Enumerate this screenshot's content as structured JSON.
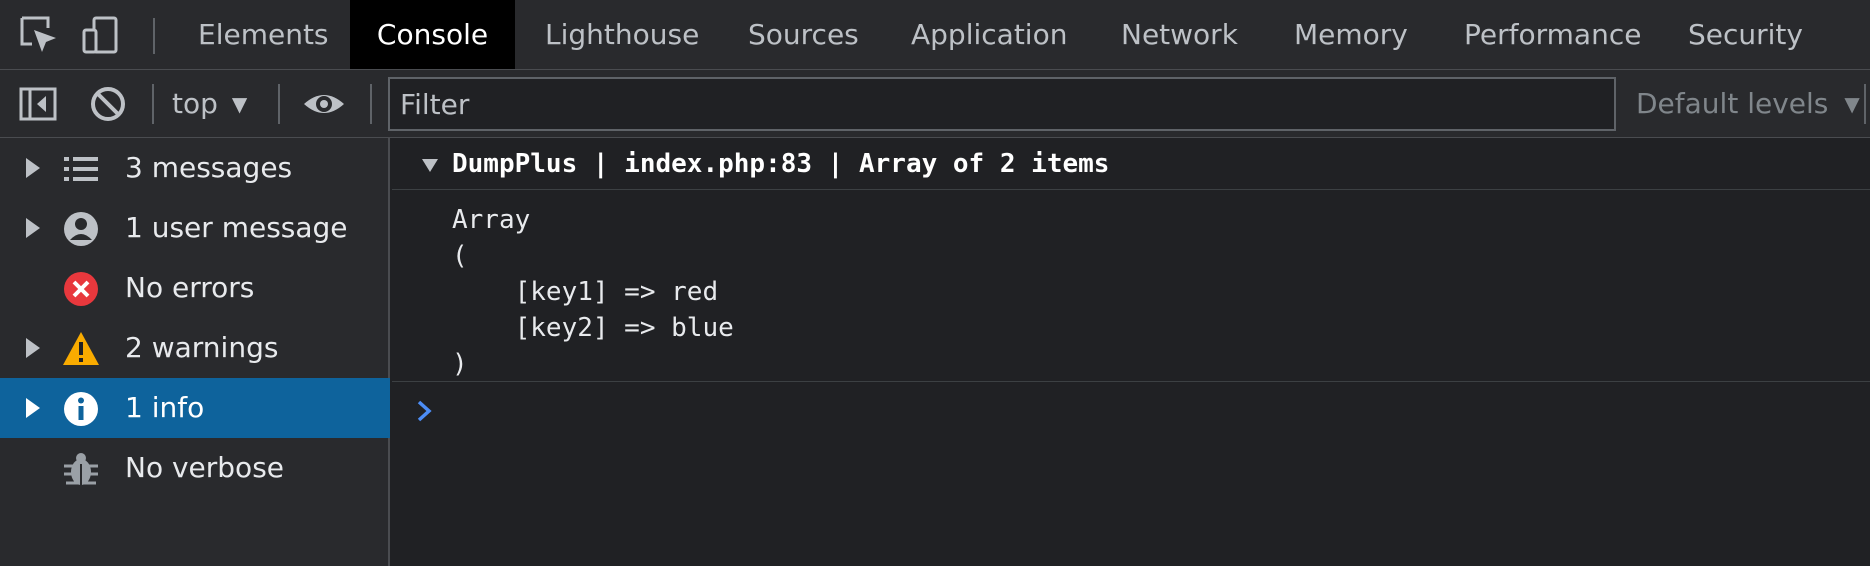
{
  "tabs": [
    {
      "label": "Elements",
      "active": false
    },
    {
      "label": "Console",
      "active": true
    },
    {
      "label": "Lighthouse",
      "active": false
    },
    {
      "label": "Sources",
      "active": false
    },
    {
      "label": "Application",
      "active": false
    },
    {
      "label": "Network",
      "active": false
    },
    {
      "label": "Memory",
      "active": false
    },
    {
      "label": "Performance",
      "active": false
    },
    {
      "label": "Security",
      "active": false
    }
  ],
  "toolbar": {
    "context": "top",
    "filter_placeholder": "Filter",
    "levels": "Default levels"
  },
  "sidebar": {
    "items": [
      {
        "label": "3 messages",
        "icon": "list-icon",
        "expandable": true
      },
      {
        "label": "1 user message",
        "icon": "user-icon",
        "expandable": true
      },
      {
        "label": "No errors",
        "icon": "error-icon",
        "expandable": false
      },
      {
        "label": "2 warnings",
        "icon": "warning-icon",
        "expandable": true
      },
      {
        "label": "1 info",
        "icon": "info-icon",
        "expandable": true,
        "selected": true
      },
      {
        "label": "No verbose",
        "icon": "bug-icon",
        "expandable": false
      }
    ]
  },
  "console": {
    "group_title": "DumpPlus | index.php:83 | Array of 2 items",
    "dump": "Array\n(\n    [key1] => red\n    [key2] => blue\n)"
  },
  "colors": {
    "accent_selected": "#0e639c",
    "error": "#e8383d",
    "warning": "#f9ab00",
    "prompt": "#4c8df6"
  }
}
